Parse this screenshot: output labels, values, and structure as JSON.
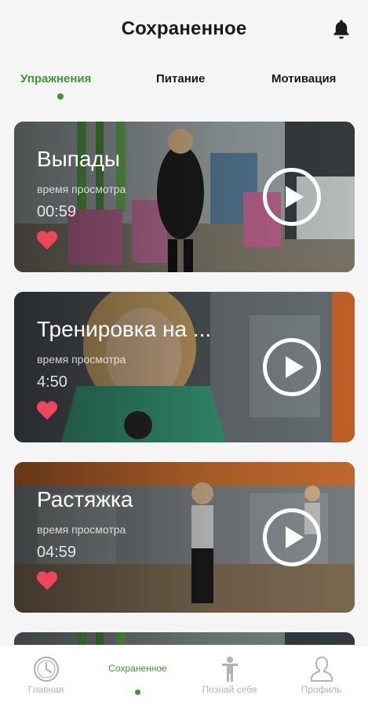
{
  "header": {
    "title": "Сохраненное",
    "bell_icon": "bell-icon"
  },
  "tabs": [
    {
      "label": "Упражнения",
      "active": true
    },
    {
      "label": "Питание",
      "active": false
    },
    {
      "label": "Мотивация",
      "active": false
    }
  ],
  "cards": [
    {
      "title": "Выпады",
      "subtitle": "время просмотра",
      "time": "00:59",
      "liked": true
    },
    {
      "title": "Тренировка на ...",
      "subtitle": "время просмотра",
      "time": "4:50",
      "liked": true
    },
    {
      "title": "Растяжка",
      "subtitle": "время просмотра",
      "time": "04:59",
      "liked": true
    }
  ],
  "nav": [
    {
      "label": "Главная",
      "icon": "clock-icon",
      "active": false
    },
    {
      "label": "Сохраненное",
      "icon": "bookmark-icon",
      "active": true
    },
    {
      "label": "Познай себя",
      "icon": "person-icon",
      "active": false
    },
    {
      "label": "Профиль",
      "icon": "profile-icon",
      "active": false
    }
  ],
  "colors": {
    "accent": "#3a9a2e",
    "heart": "#f0465a",
    "inactive": "#b3b3b3"
  }
}
